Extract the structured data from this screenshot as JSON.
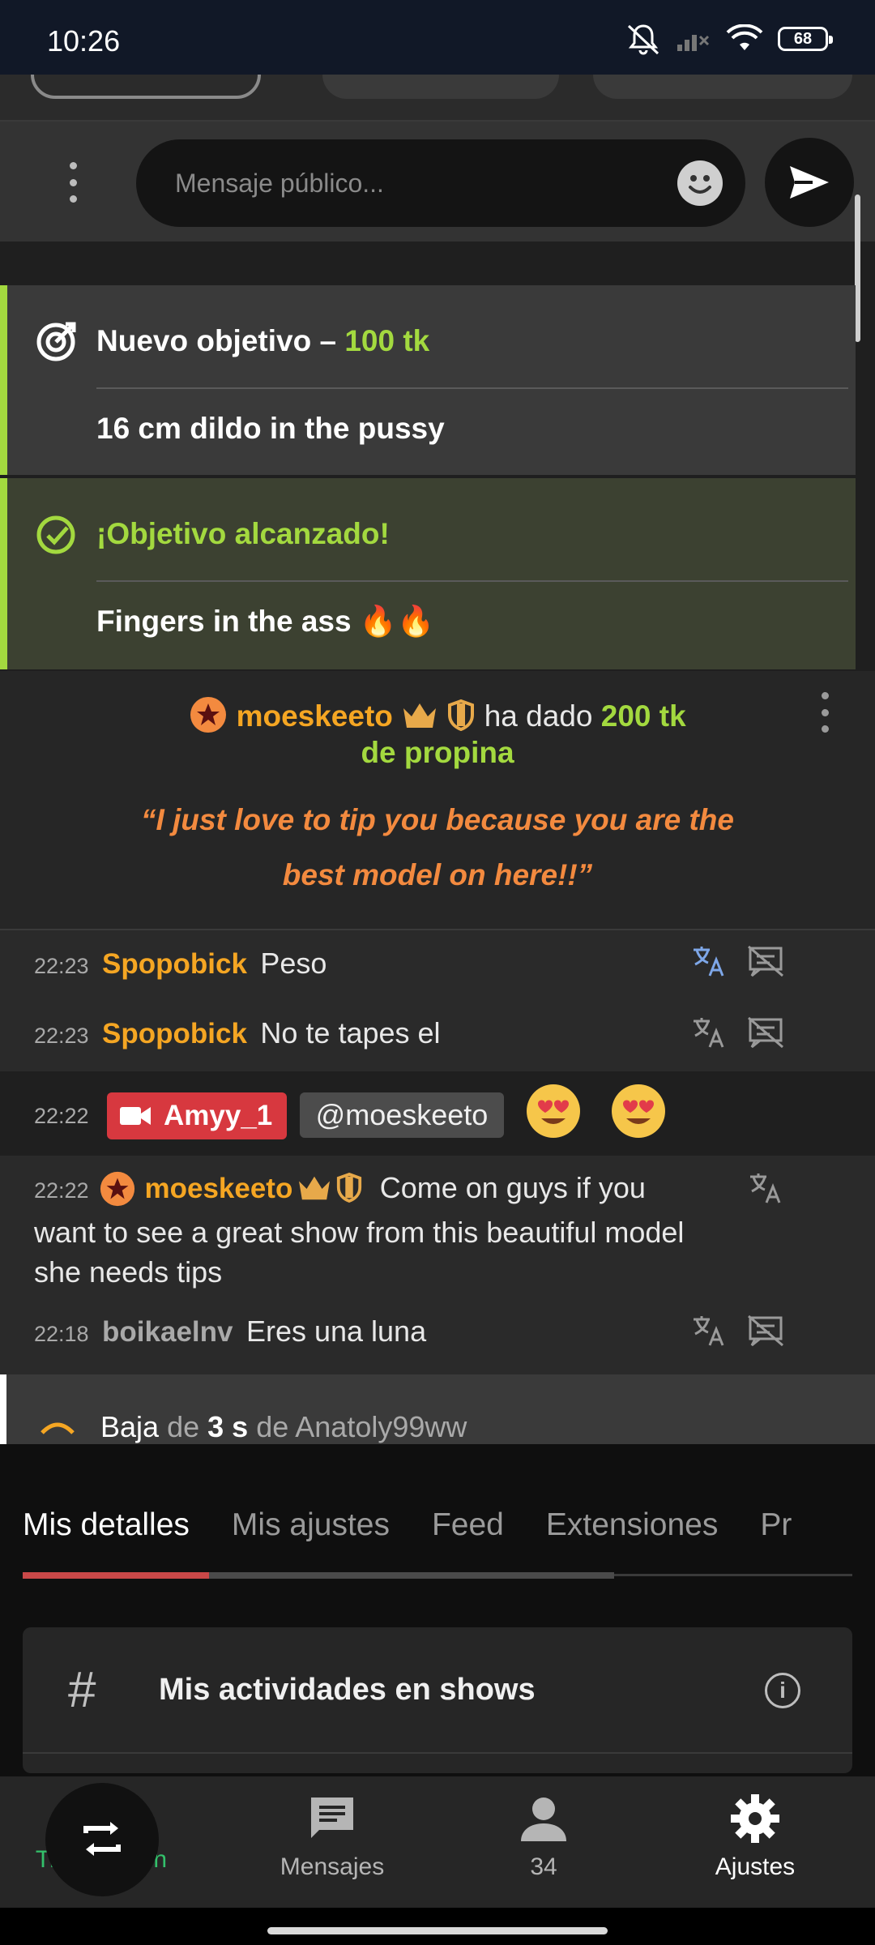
{
  "status_bar": {
    "time": "10:26",
    "battery": "68"
  },
  "composer": {
    "placeholder": "Mensaje público..."
  },
  "goals": [
    {
      "prefix": "Nuevo objetivo – ",
      "amount": "100 tk",
      "body": "16 cm dildo in the pussy"
    },
    {
      "title": "¡Objetivo alcanzado!",
      "body": "Fingers in the ass 🔥🔥"
    }
  ],
  "tip": {
    "user": "moeskeeto",
    "action": "ha dado",
    "amount": "200 tk",
    "suffix": "de propina",
    "quote": "“I just love to tip you because you are the best model on here!!”"
  },
  "chat": [
    {
      "time": "22:23",
      "user": "Spopobick",
      "text": "Peso"
    },
    {
      "time": "22:23",
      "user": "Spopobick",
      "text": "No te tapes el"
    },
    {
      "time": "22:22",
      "user": "Amyy_1",
      "mention": "@moeskeeto"
    },
    {
      "time": "22:22",
      "user": "moeskeeto",
      "text_line1": "Come on guys if you",
      "text_line2": "want to see a great show from this beautiful model",
      "text_line3": "she needs tips"
    },
    {
      "time": "22:18",
      "user": "boikaelnv",
      "text": "Eres una luna"
    }
  ],
  "event": {
    "type": "Baja",
    "de": "de",
    "duration": "3 s",
    "de2": "de",
    "user": "Anatoly99ww"
  },
  "tabs": [
    "Mis detalles",
    "Mis ajustes",
    "Feed",
    "Extensiones",
    "Pr"
  ],
  "card": {
    "title": "Mis actividades en shows",
    "hash": "#",
    "info": "i"
  },
  "nav": [
    {
      "label": "Transmisión"
    },
    {
      "label": "Mensajes"
    },
    {
      "label": "34"
    },
    {
      "label": "Ajustes"
    }
  ],
  "colors": {
    "accent_green": "#a3d93f",
    "user_orange": "#f5a623",
    "tip_orange": "#f38a3f",
    "cam_red": "#d7383f"
  }
}
